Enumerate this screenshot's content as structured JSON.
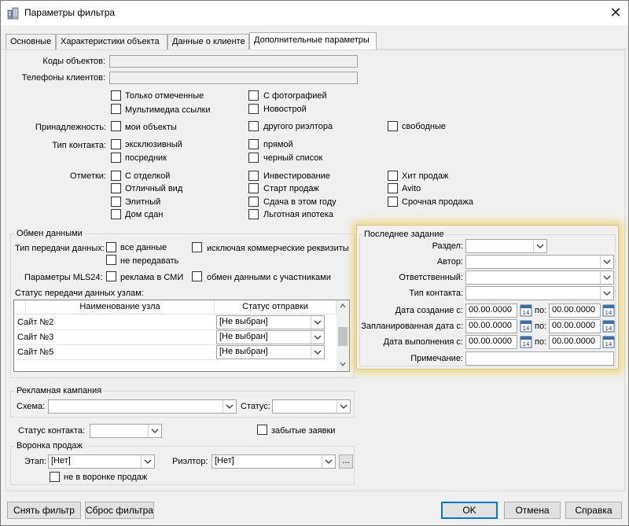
{
  "window": {
    "title": "Параметры фильтра",
    "close_glyph": "✕"
  },
  "tabs": [
    {
      "label": "Основные",
      "active": false
    },
    {
      "label": "Характеристики объекта",
      "active": false
    },
    {
      "label": "Данные о клиенте",
      "active": false
    },
    {
      "label": "Дополнительные параметры",
      "active": true
    }
  ],
  "fields": {
    "object_codes_label": "Коды объектов:",
    "client_phones_label": "Телефоны клиентов:"
  },
  "flags": {
    "only_marked": "Только отмеченные",
    "with_photo": "С фотографией",
    "multimedia_links": "Мультимедиа ссылки",
    "new_building": "Новострой"
  },
  "ownership": {
    "label": "Принадлежность:",
    "my_objects": "мои объекты",
    "other_realtor": "другого риэлтора",
    "free": "свободные"
  },
  "contact_type": {
    "label": "Тип контакта:",
    "exclusive": "эксклюзивный",
    "direct": "прямой",
    "intermediary": "посредник",
    "blacklist": "черный список"
  },
  "marks": {
    "label": "Отметки:",
    "with_finish": "С отделкой",
    "investment": "Инвестирование",
    "hit_sales": "Хит продаж",
    "excellent_view": "Отличный вид",
    "sales_start": "Старт продаж",
    "avito": "Avito",
    "elite": "Элитный",
    "delivery_this_year": "Сдача в этом году",
    "urgent_sale": "Срочная продажа",
    "house_delivered": "Дом сдан",
    "preferential_mortgage": "Льготная ипотека"
  },
  "exchange": {
    "title": "Обмен данными",
    "transfer_type_label": "Тип передачи данных:",
    "all_data": "все данные",
    "exclude_commercial": "исключая коммерческие реквизиты",
    "do_not_transfer": "не передавать",
    "mls_label": "Параметры MLS24:",
    "ad_in_media": "реклама в СМИ",
    "exchange_with_participants": "обмен данными с участниками",
    "node_status_label": "Статус передачи данных узлам:",
    "grid": {
      "col_node": "Наименование узла",
      "col_status": "Статус отправки",
      "rows": [
        {
          "node": "Сайт №2",
          "status": "[Не выбран]"
        },
        {
          "node": "Сайт №3",
          "status": "[Не выбран]"
        },
        {
          "node": "Сайт №5",
          "status": "[Не выбран]"
        }
      ]
    }
  },
  "last_task": {
    "title": "Последнее задание",
    "section_label": "Раздел:",
    "author_label": "Автор:",
    "responsible_label": "Ответственный:",
    "contact_type_label": "Тип контакта:",
    "created_from_label": "Дата создание с:",
    "planned_from_label": "Запланированная дата с:",
    "done_from_label": "Дата выполнения с:",
    "to_label": "по:",
    "date_placeholder": "00.00.0000",
    "note_label": "Примечание:"
  },
  "campaign": {
    "title": "Рекламная кампания",
    "scheme_label": "Схема:",
    "status_label": "Статус:"
  },
  "contact_status": {
    "label": "Статус контакта:",
    "forgotten_requests": "забытые заявки"
  },
  "funnel": {
    "title": "Воронка продаж",
    "stage_label": "Этап:",
    "stage_value": "[Нет]",
    "realtor_label": "Риэлтор:",
    "realtor_value": "[Нет]",
    "more_button": "...",
    "not_in_funnel": "не в воронке продаж"
  },
  "buttons": {
    "remove_filter": "Снять фильтр",
    "reset_filter": "Сброс фильтра",
    "ok": "OK",
    "cancel": "Отмена",
    "help": "Справка"
  }
}
